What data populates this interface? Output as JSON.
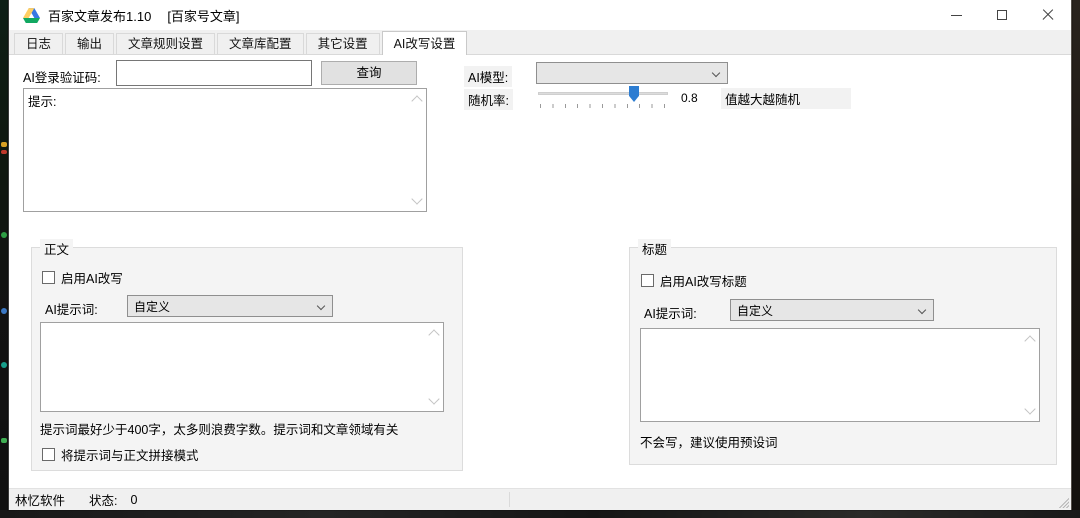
{
  "window": {
    "title": "百家文章发布1.10",
    "context": "[百家号文章]"
  },
  "tabs": [
    {
      "label": "日志"
    },
    {
      "label": "输出"
    },
    {
      "label": "文章规则设置"
    },
    {
      "label": "文章库配置"
    },
    {
      "label": "其它设置"
    },
    {
      "label": "AI改写设置",
      "active": true
    }
  ],
  "ai_login": {
    "label": "AI登录验证码:",
    "value": "",
    "query_button": "查询"
  },
  "ai_model": {
    "label": "AI模型:",
    "selected_value": ""
  },
  "randomness": {
    "label": "随机率:",
    "value": "0.8",
    "hint": "值越大越随机"
  },
  "prompt_display": {
    "text": "提示:"
  },
  "body_group": {
    "title": "正文",
    "enable_checkbox": "启用AI改写",
    "prompt_label": "AI提示词:",
    "prompt_selected": "自定义",
    "textarea_value": "",
    "note": "提示词最好少于400字，太多则浪费字数。提示词和文章领域有关",
    "concat_checkbox": "将提示词与正文拼接模式"
  },
  "title_group": {
    "title": "标题",
    "enable_checkbox": "启用AI改写标题",
    "prompt_label": "AI提示词:",
    "prompt_selected": "自定义",
    "textarea_value": "",
    "note": "不会写，建议使用预设词"
  },
  "status_bar": {
    "brand": "林忆软件",
    "status_label": "状态:",
    "status_value": "0"
  },
  "colors": {
    "slider_thumb": "#2d7dd2",
    "tab_strip_bg": "#f0f0f0",
    "button_bg": "#e1e1e1"
  }
}
